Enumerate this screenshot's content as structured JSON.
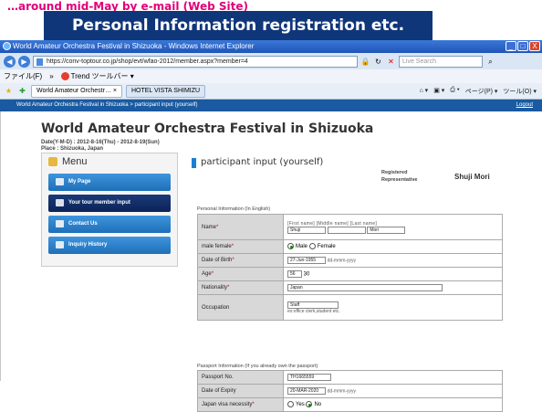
{
  "slide": {
    "header_text": "…around mid-May by e-mail (Web Site)",
    "banner": "Personal Information registration etc."
  },
  "window": {
    "title": "World Amateur Orchestra Festival in Shizuoka - Windows Internet Explorer",
    "controls": [
      "_",
      "□",
      "X"
    ]
  },
  "browser": {
    "url": "https://conv-toptour.co.jp/shop/evt/wfao-2012/member.aspx?member=4",
    "search_placeholder": "Live Search",
    "menu_items": [
      "ファイル(F)",
      "»",
      "Trend ツールバー ▾"
    ],
    "tabs": [
      "World Amateur Orchestr… ×",
      "HOTEL VISTA SHIMIZU"
    ],
    "tab_tools": [
      "⌂ ▾",
      "▣ ▾",
      "⎙ ▾",
      "ページ(P) ▾",
      "ツール(O) ▾"
    ]
  },
  "site_nav": {
    "breadcrumb": "World Amateur Orchestra Festival in Shizuoka > participant input (yourself)",
    "logout": "Logout"
  },
  "site": {
    "title": "World Amateur Orchestra Festival in Shizuoka",
    "date": "Date(Y-M-D) : 2012-8-16(Thu) - 2012-8-19(Sun)",
    "place": "Place : Shizuoka, Japan"
  },
  "menu": {
    "heading": "Menu",
    "items": [
      {
        "label": "My Page",
        "active": false
      },
      {
        "label": "Your tour member input",
        "active": true
      },
      {
        "label": "Contact Us",
        "active": false
      },
      {
        "label": "Inquiry History",
        "active": false
      }
    ]
  },
  "content": {
    "title": "participant input (yourself)",
    "rep_label_line1": "Registered",
    "rep_label_line2": "Representative",
    "rep_name": "Shuji Mori",
    "personal_section": "Personal Information (In English)",
    "passport_section": "Passport Information (If you already own the passport)",
    "fields": {
      "name_label": "Name",
      "name_sublabels": "[First name]    [Middle name]    [Last name]",
      "first_name": "Shuji",
      "middle_name": "",
      "last_name": "Mori",
      "gender_label": "male female",
      "gender_male": "Male",
      "gender_female": "Female",
      "dob_label": "Date of Birth",
      "dob_value": "27-Jun-1955",
      "dob_hint": "dd-mmm-yyyy",
      "age_label": "Age",
      "age_value": "56",
      "age_display": "30",
      "nationality_label": "Nationality",
      "nationality_value": "Japan",
      "occupation_label": "Occupation",
      "occupation_value": "Staff",
      "occupation_hint": "ex:office clerk,student etc.",
      "passport_no_label": "Passport No.",
      "passport_no_value": "TH1665559",
      "expiry_label": "Date of Expiry",
      "expiry_value": "20-MAR-2020",
      "expiry_hint": "dd-mmm-yyyy",
      "visa_label": "Japan visa necessity",
      "visa_yes": "Yes",
      "visa_no": "No"
    }
  },
  "colors": {
    "banner_bg": "#10367a",
    "header_pink": "#e0007a",
    "menu_button": "#1e6fb8",
    "menu_button_active": "#0b2458",
    "site_nav_bg": "#1a5aa0"
  }
}
